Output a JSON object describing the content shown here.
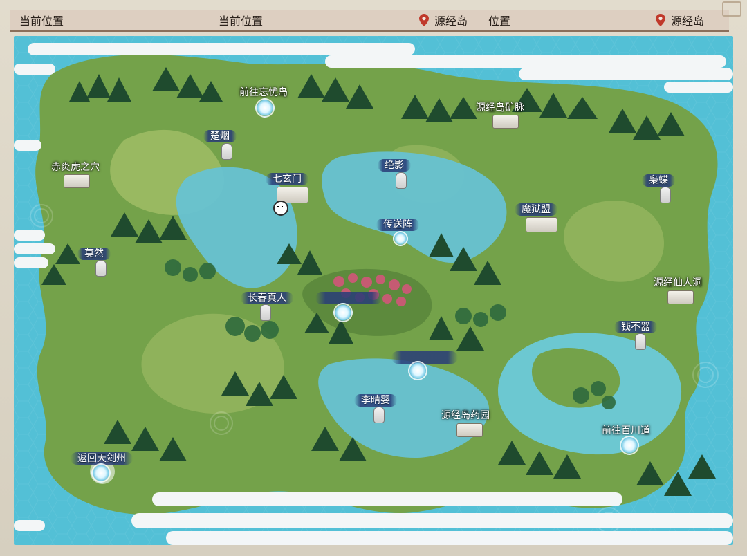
{
  "header": {
    "left_title_1": "当前位置",
    "left_title_2": "当前位置",
    "right_title_1": "位置",
    "location_1": "源经岛",
    "location_2": "源经岛"
  },
  "map": {
    "labels": {
      "qianwang_wangyou": "前往忘忧岛",
      "yuanjing_kuangmai": "源经岛矿脉",
      "chuyan": "楚烟",
      "chiyan_huzhixue": "赤炎虎之穴",
      "qixuanmen": "七玄门",
      "jueying": "绝影",
      "shuangdie": "枭蝶",
      "moyumeng": "魔狱盟",
      "chuansongzhen": "传送阵",
      "moran": "莫然",
      "yuanjing_xianrendong": "源经仙人洞",
      "changchun_zhenren": "长春真人",
      "qianbuqi": "钱不器",
      "liqingying": "李晴婴",
      "yuanjing_yaoyuan": "源经岛药园",
      "qianwang_baichuandao": "前往百川道",
      "fanhui_tianjianzhou": "返回天剑州"
    }
  },
  "colors": {
    "sea": "#53c0d6",
    "sea_dark": "#2fa6c0",
    "land": "#74a24a",
    "land_light": "#a6c06a",
    "mountain_dark": "#1f4b2e",
    "mountain_mid": "#2f6a3d",
    "cloud": "#f3f6f7",
    "pin": "#c0392b",
    "banner": "#283c78"
  }
}
